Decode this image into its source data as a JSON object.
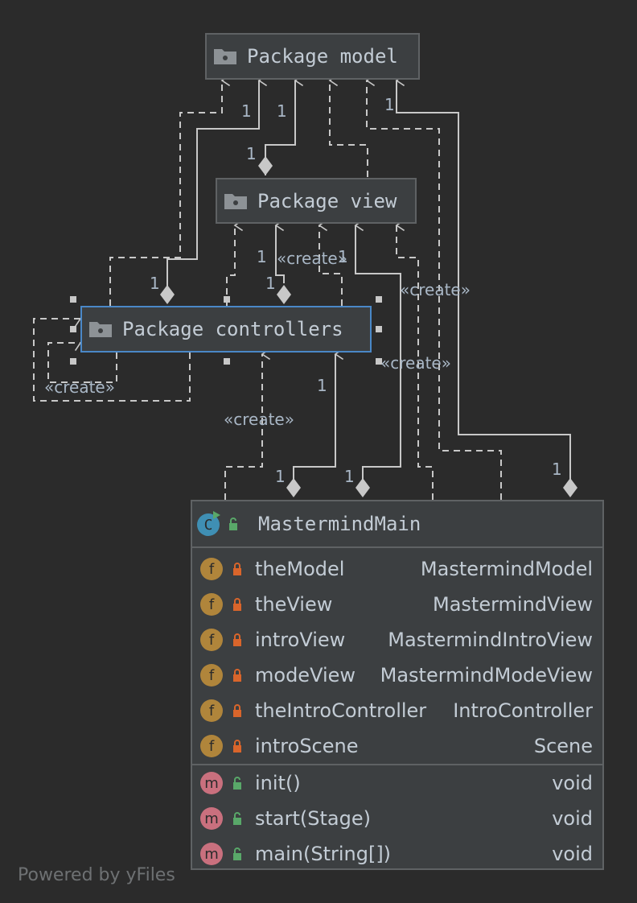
{
  "packages": {
    "model": "Package model",
    "view": "Package view",
    "controllers": "Package controllers"
  },
  "class": {
    "name": "MastermindMain",
    "fields": [
      {
        "name": "theModel",
        "type": "MastermindModel"
      },
      {
        "name": "theView",
        "type": "MastermindView"
      },
      {
        "name": "introView",
        "type": "MastermindIntroView"
      },
      {
        "name": "modeView",
        "type": "MastermindModeView"
      },
      {
        "name": "theIntroController",
        "type": "IntroController"
      },
      {
        "name": "introScene",
        "type": "Scene"
      }
    ],
    "methods": [
      {
        "name": "init()",
        "type": "void"
      },
      {
        "name": "start(Stage)",
        "type": "void"
      },
      {
        "name": "main(String[])",
        "type": "void"
      }
    ]
  },
  "labels": {
    "one": "1",
    "create": "«create»"
  },
  "field_badge": "f",
  "method_badge": "m",
  "class_badge": "C",
  "footer": "Powered by yFiles",
  "colors": {
    "background": "#2b2b2b",
    "node_fill": "#3c3f41",
    "node_border": "#5f6264",
    "selected_border": "#4a88c7",
    "edge": "#c8c8c8",
    "field_badge": "#b0853b",
    "method_badge": "#c9707e",
    "private_lock": "#d9652b",
    "public_lock": "#59a869"
  }
}
